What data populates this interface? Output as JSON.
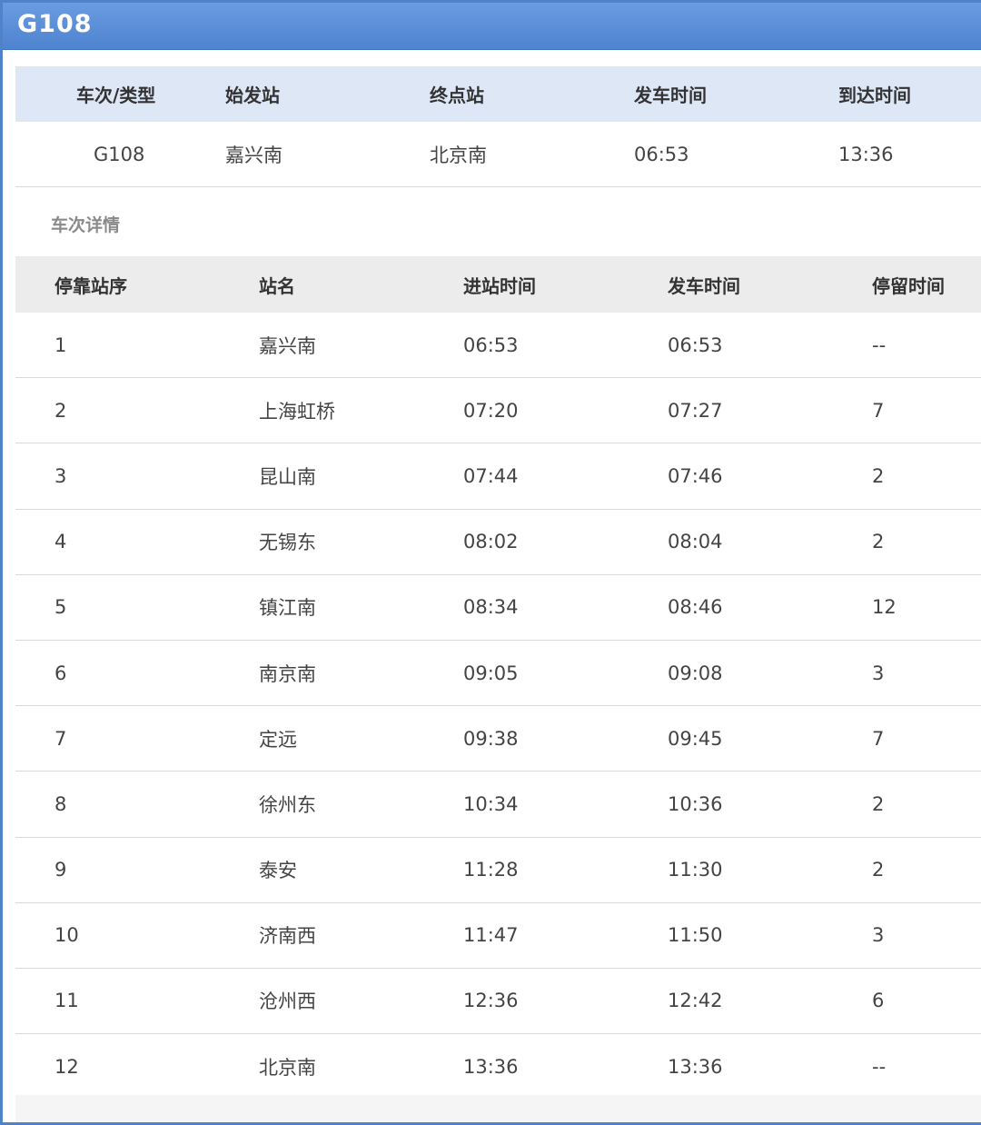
{
  "window": {
    "title": "G108"
  },
  "summary": {
    "headers": [
      "车次/类型",
      "始发站",
      "终点站",
      "发车时间",
      "到达时间"
    ],
    "values": [
      "G108",
      "嘉兴南",
      "北京南",
      "06:53",
      "13:36"
    ]
  },
  "details": {
    "label": "车次详情",
    "headers": [
      "停靠站序",
      "站名",
      "进站时间",
      "发车时间",
      "停留时间"
    ],
    "rows": [
      [
        "1",
        "嘉兴南",
        "06:53",
        "06:53",
        "--"
      ],
      [
        "2",
        "上海虹桥",
        "07:20",
        "07:27",
        "7"
      ],
      [
        "3",
        "昆山南",
        "07:44",
        "07:46",
        "2"
      ],
      [
        "4",
        "无锡东",
        "08:02",
        "08:04",
        "2"
      ],
      [
        "5",
        "镇江南",
        "08:34",
        "08:46",
        "12"
      ],
      [
        "6",
        "南京南",
        "09:05",
        "09:08",
        "3"
      ],
      [
        "7",
        "定远",
        "09:38",
        "09:45",
        "7"
      ],
      [
        "8",
        "徐州东",
        "10:34",
        "10:36",
        "2"
      ],
      [
        "9",
        "泰安",
        "11:28",
        "11:30",
        "2"
      ],
      [
        "10",
        "济南西",
        "11:47",
        "11:50",
        "3"
      ],
      [
        "11",
        "沧州西",
        "12:36",
        "12:42",
        "6"
      ],
      [
        "12",
        "北京南",
        "13:36",
        "13:36",
        "--"
      ]
    ]
  },
  "colors": {
    "accent": "#4f83c9",
    "summary_header_bg": "#dde7f6",
    "detail_header_bg": "#ececec"
  }
}
